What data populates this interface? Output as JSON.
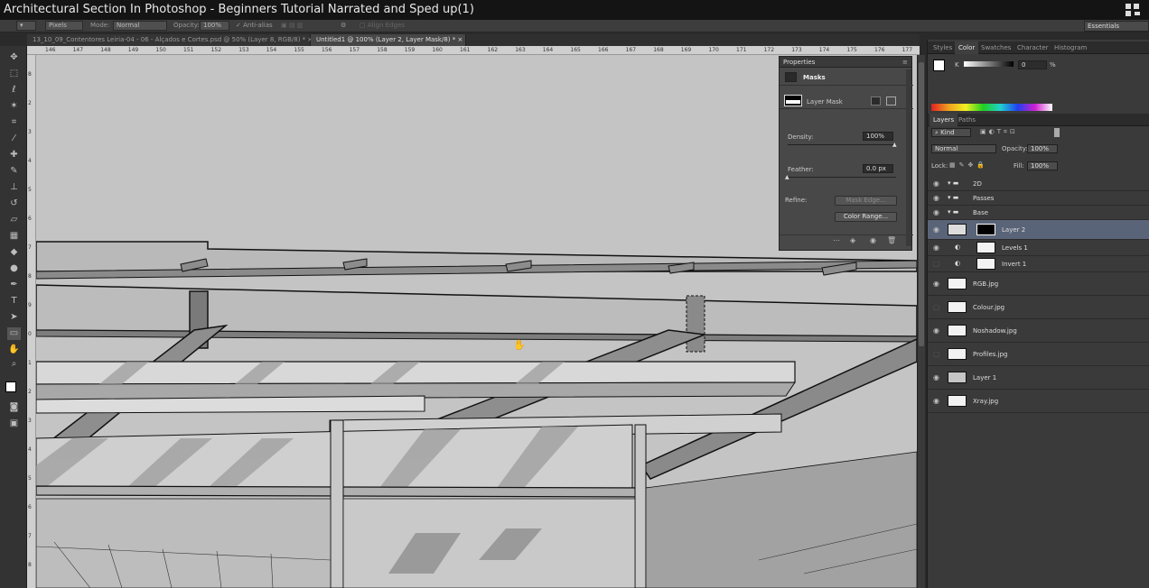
{
  "window": {
    "title": "Architectural Section In Photoshop - Beginners Tutorial Narrated and Sped up(1)"
  },
  "options_bar": {
    "units": "Pixels",
    "mode_label": "Mode:",
    "mode_value": "Normal",
    "opacity_label": "Opacity:",
    "opacity_value": "100%",
    "antialias_label": "Anti-alias",
    "align_edges_label": "Align Edges",
    "workspace": "Essentials"
  },
  "doc_tabs": [
    {
      "label": "13_10_09_Contentores Leiria-04 - 06 - Alçados e Cortes.psd @ 50% (Layer 8, RGB/8) *",
      "close": "×"
    },
    {
      "label": "Untitled1 @ 100% (Layer 2, Layer Mask/8) *",
      "close": "×"
    }
  ],
  "ruler_top": [
    "146",
    "147",
    "148",
    "149",
    "150",
    "151",
    "152",
    "153",
    "154",
    "155",
    "156",
    "157",
    "158",
    "159",
    "160",
    "161",
    "162",
    "163",
    "164",
    "165",
    "166",
    "167",
    "168",
    "169",
    "170",
    "171",
    "172",
    "173",
    "174",
    "175",
    "176",
    "177"
  ],
  "ruler_left": [
    "8",
    "2",
    "3",
    "4",
    "5",
    "6",
    "7",
    "8",
    "9",
    "0",
    "1",
    "2",
    "3",
    "4",
    "5",
    "6",
    "7",
    "8"
  ],
  "properties": {
    "title": "Properties",
    "section": "Masks",
    "mask_label": "Layer Mask",
    "density_label": "Density:",
    "density_value": "100%",
    "feather_label": "Feather:",
    "feather_value": "0.0 px",
    "refine_label": "Refine:",
    "mask_edge_button": "Mask Edge...",
    "color_range_button": "Color Range..."
  },
  "color_panel": {
    "tabs": [
      "Styles",
      "Color",
      "Swatches",
      "Character",
      "Histogram"
    ],
    "active_tab": "Color",
    "channel": "K",
    "value": "0",
    "unit": "%"
  },
  "layers_panel": {
    "tabs": [
      "Layers",
      "Paths"
    ],
    "kind_label": "Kind",
    "blend_mode": "Normal",
    "opacity_label": "Opacity:",
    "opacity_value": "100%",
    "lock_label": "Lock:",
    "fill_label": "Fill:",
    "fill_value": "100%",
    "layers": [
      {
        "name": "2D",
        "type": "group"
      },
      {
        "name": "Passes",
        "type": "group"
      },
      {
        "name": "Base",
        "type": "group"
      },
      {
        "name": "Layer 2",
        "type": "masked",
        "selected": true
      },
      {
        "name": "Levels 1",
        "type": "adjustment"
      },
      {
        "name": "Invert 1",
        "type": "adjustment"
      },
      {
        "name": "RGB.jpg",
        "type": "image"
      },
      {
        "name": "Colour.jpg",
        "type": "image"
      },
      {
        "name": "Noshadow.jpg",
        "type": "image"
      },
      {
        "name": "Profiles.jpg",
        "type": "image"
      },
      {
        "name": "Layer 1",
        "type": "image"
      },
      {
        "name": "Xray.jpg",
        "type": "image"
      }
    ]
  }
}
